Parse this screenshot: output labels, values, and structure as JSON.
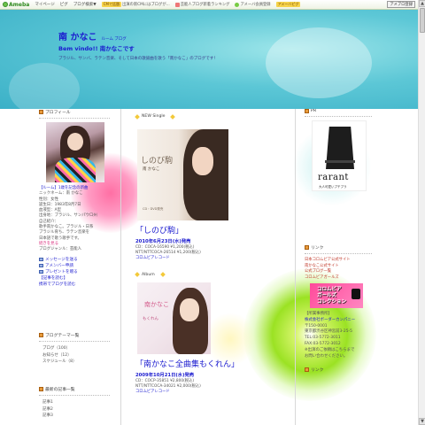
{
  "topbar": {
    "logo": "Ameba",
    "links": [
      "マイページ",
      "ピグ",
      "ブログ検索▼"
    ],
    "promo": {
      "badge": "CMで話題",
      "text": "出演の新CMにはブログが..."
    },
    "featured": "芸能人ブログ新着ランキング",
    "fav": "アメーバ会員登録",
    "highlight": "アメーバピグ",
    "button": "アメブロ登録"
  },
  "header": {
    "title": "南 かなこ",
    "title_sub": "ルーム ブログ",
    "tagline": "Bem vindo!!  南かなこです",
    "description": "ブラジル、サンバ、ラテン音楽、そして日本の歌謡曲を歌う「南かなこ」のブログです！"
  },
  "left": {
    "profile_head": "プロフィール",
    "profile_lines": [
      {
        "text": "【ルーム】1歳を記念の新曲",
        "style": "hl"
      },
      {
        "text": "ニックネーム：南 かなこ",
        "style": ""
      },
      {
        "text": "性別：女性",
        "style": ""
      },
      {
        "text": "誕生日：1983年8月7日",
        "style": ""
      },
      {
        "text": "血液型：A型",
        "style": ""
      },
      {
        "text": "出身地：ブラジル、サンパウロ州",
        "style": ""
      },
      {
        "text": "自己紹介：",
        "style": ""
      },
      {
        "text": "歌手南かなこ。ブラジル・日系",
        "style": ""
      },
      {
        "text": "ブラジル育ち、ラテン音楽を",
        "style": ""
      },
      {
        "text": "日本語で歌う歌手です。",
        "style": ""
      },
      {
        "text": "続きを見る",
        "style": "pk"
      },
      {
        "text": "ブログジャンル：芸能人",
        "style": ""
      }
    ],
    "links": [
      {
        "icon": "mail-icon",
        "text": "メッセージを送る"
      },
      {
        "icon": "member-icon",
        "text": "アメンバー申請"
      },
      {
        "icon": "gift-icon",
        "text": "プレゼントを贈る"
      }
    ],
    "extra_links": [
      "【記事を読む】",
      "携帯でブログを読む"
    ],
    "theme_head": "ブログテーマ一覧",
    "themes": [
      "ブログ（100）",
      "お知らせ（12）",
      "スケジュール（8）"
    ],
    "recent_head": "最新の記事一覧",
    "recent": [
      "記事1",
      "記事2",
      "記事3"
    ]
  },
  "center": {
    "posts": [
      {
        "label": "NEW Single",
        "cover": {
          "title": "しのび駒",
          "artist": "南 かなこ",
          "note": "CD・DVD発売"
        },
        "title": "「しのび駒」",
        "date": "2010年6月23日(水)発売",
        "info": [
          "CD：COCA-16590 ¥1,200(税込)",
          "NTT/NTTCOCA-26514 ¥1,200(税込)"
        ],
        "link": "コロムビアレコード"
      },
      {
        "label": "Album",
        "cover": {
          "title": "南かなこ",
          "subtitle": "もくれん"
        },
        "title": "「南かなこ全曲集もくれん」",
        "date": "2009年10月21日(水)発売",
        "info": [
          "CD：COCP-35851 ¥2,800(税込)",
          "NTT/NTTCOCA-34021 ¥2,000(税込)"
        ],
        "link": "コロムビアレコード"
      }
    ]
  },
  "right": {
    "pr_head": "PR",
    "ad_brand": "rarant",
    "ad_sub": "大人可愛いプチプラ",
    "links_head": "リンク",
    "red_links": [
      "日本コロムビア公式サイト",
      "南かなこ公式サイト",
      "公式ブログ一覧",
      "コロムビアガールズ"
    ],
    "banner_text": "コロムビア\nガールズ\nコレクション",
    "office_lines": [
      {
        "text": "【所属事務所】",
        "style": ""
      },
      {
        "text": "株式会社ボーダーカンパニー",
        "style": "hl"
      },
      {
        "text": "〒150-0001",
        "style": ""
      },
      {
        "text": "東京都渋谷区神宮前3-25-5",
        "style": ""
      },
      {
        "text": "TEL:03-5772-3011",
        "style": ""
      },
      {
        "text": "FAX:03-5772-3012",
        "style": ""
      },
      {
        "text": "※出演のご依頼はこちらまで",
        "style": ""
      },
      {
        "text": "お問い合わせください。",
        "style": ""
      }
    ],
    "more_head": "リンク"
  }
}
